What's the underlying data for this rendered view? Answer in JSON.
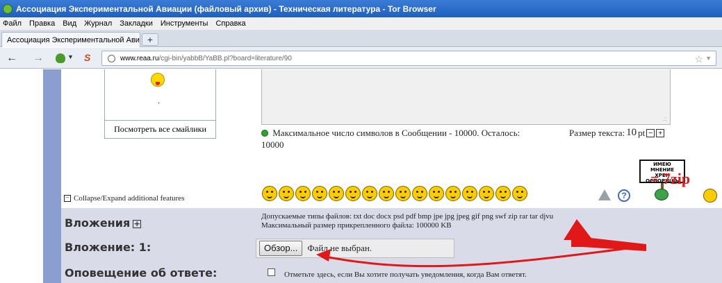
{
  "window": {
    "title": "Ассоциация Экспериментальной Авиации (файловый архив) - Техническая литература - Tor Browser"
  },
  "menu": [
    "Файл",
    "Правка",
    "Вид",
    "Журнал",
    "Закладки",
    "Инструменты",
    "Справка"
  ],
  "tab": {
    "label": "Ассоциация Экспериментальной Авиаци...",
    "new_tab": "+"
  },
  "nav": {
    "back": "←",
    "forward": "→",
    "url_domain": "www.reaa.ru",
    "url_path": "/cgi-bin/yabbB/YaBB.pl?board=literature/90"
  },
  "smilies": {
    "dot": ".",
    "view_all": "Посмотреть все смайлики"
  },
  "editor": {
    "max_chars_text": "Максимальное число символов в Сообщении - 10000. Осталось:",
    "remaining": "10000",
    "text_size_label": "Размер текста:",
    "text_size_value": "10",
    "text_size_unit": "pt",
    "minus": "−",
    "plus": "+"
  },
  "sign_text": [
    "ИМЕЮ",
    "МНЕНИЕ",
    "ХРЕН",
    "ОСПОРИШЬ"
  ],
  "collapse": {
    "box": "−",
    "label": "Collapse/Expand additional features"
  },
  "help": "?",
  "attachments": {
    "section_label": "Вложения",
    "section_toggle": "+",
    "file_types": "Допускаемые типы файлов: txt doc docx psd pdf bmp jpe jpg jpeg gif png swf zip rar tar djvu",
    "max_size": "Максимальный размер прикрепленного файла: 100000 KB",
    "attachment_label": "Вложение: 1:",
    "browse_button": "Обзор...",
    "no_file": "Файл не выбран."
  },
  "notify": {
    "label": "Оповещение об ответе:",
    "text": "Отметьте здесь, если Вы хотите получать уведомления, когда Вам ответят."
  },
  "annotation": {
    "text": "= 7zip",
    "color": "#e01818"
  }
}
